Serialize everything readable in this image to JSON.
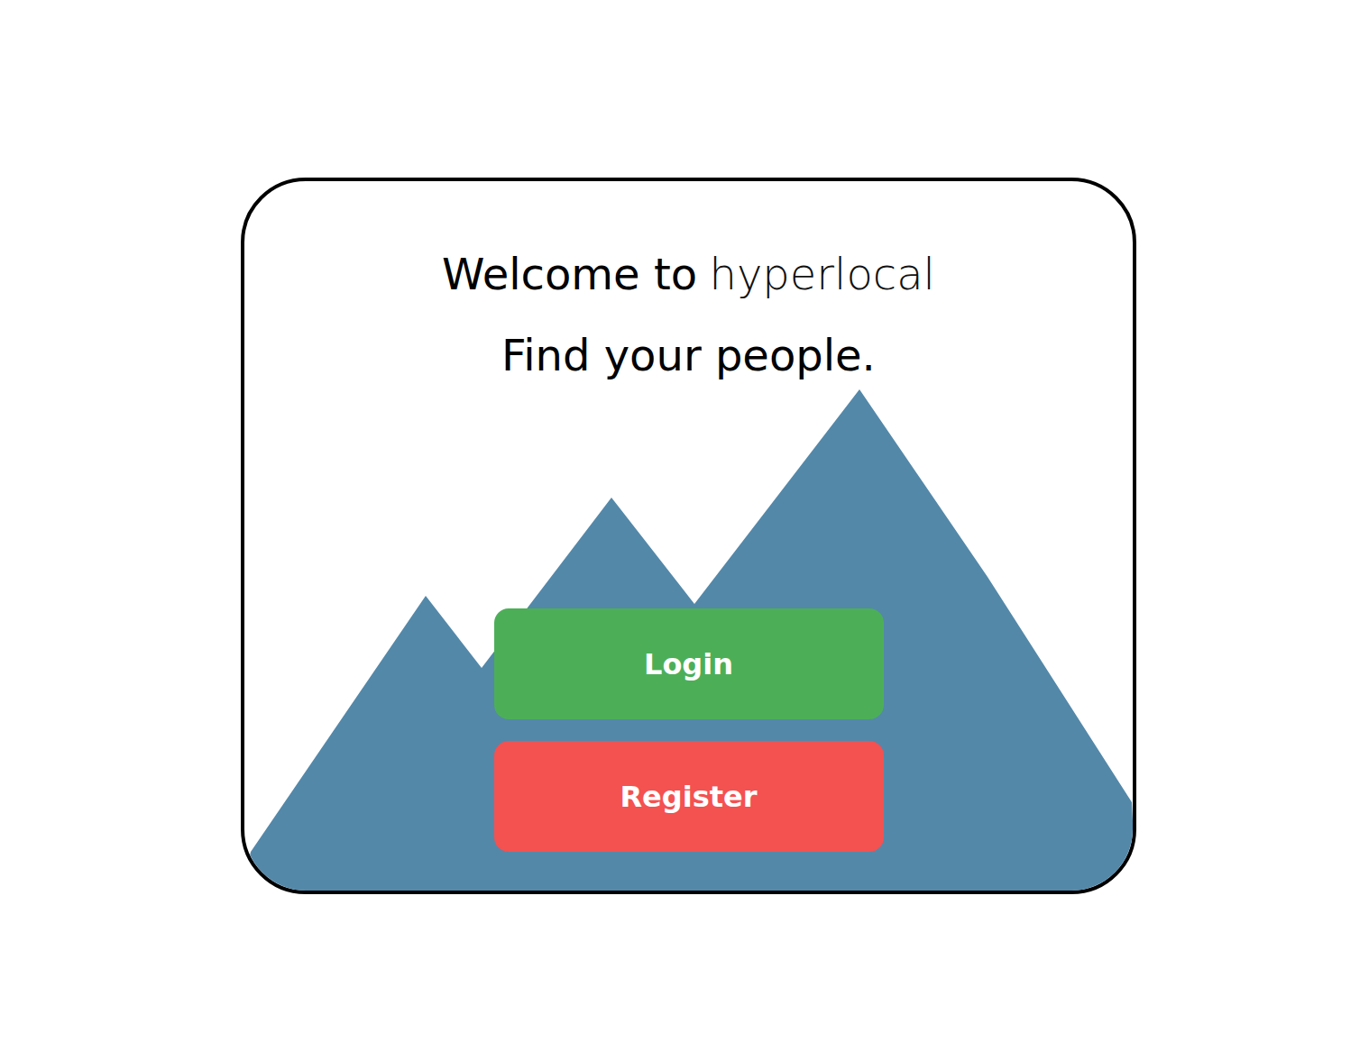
{
  "heading": {
    "welcome": "Welcome to",
    "brand": "hyperlocal"
  },
  "tagline": "Find your people.",
  "buttons": [
    {
      "label": "Login",
      "color": "#4caf58"
    },
    {
      "label": "Register",
      "color": "#f45151"
    }
  ]
}
